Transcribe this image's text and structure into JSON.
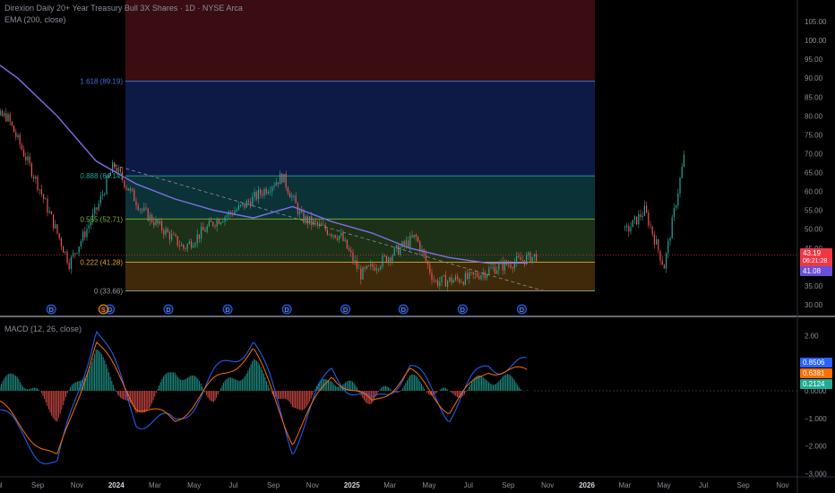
{
  "header": {
    "symbol_title": "Direxion Daily 20+ Year Treasury Bull 3X Shares · 1D · NYSE Arca",
    "indicator_title": "EMA (200, close)"
  },
  "macd_panel": {
    "title": "MACD (12, 26, close)"
  },
  "price_axis": {
    "ticks": [
      "105.00",
      "100.00",
      "95.00",
      "90.00",
      "85.00",
      "80.00",
      "75.00",
      "70.00",
      "65.00",
      "60.00",
      "55.00",
      "50.00",
      "45.00",
      "40.00",
      "35.00",
      "30.00"
    ]
  },
  "macd_axis": {
    "ticks": [
      "2.00",
      "1.00",
      "0.0000",
      "−1.000",
      "−2.000",
      "−3.000"
    ]
  },
  "time_axis": {
    "labels": [
      "Jul",
      "Sep",
      "Nov",
      "2024",
      "Mar",
      "May",
      "Jul",
      "Sep",
      "Nov",
      "2025",
      "Mar",
      "May",
      "Jul",
      "Sep",
      "Nov",
      "2026",
      "Mar",
      "May",
      "Jul",
      "Sep",
      "Nov"
    ]
  },
  "price_tags": {
    "last_price": "43.19",
    "countdown": "06:21:28",
    "ema_value": "41.08",
    "macd_value": "0.8506",
    "signal_value": "0.6381",
    "histogram_value": "0.2124"
  },
  "fib_levels": [
    {
      "label": "1.618 (89.19)",
      "price": 89.19,
      "color": "#3f6fd8",
      "fill": "#0d1a46"
    },
    {
      "label": "0.888 (64.14)",
      "price": 64.14,
      "color": "#26a69a",
      "fill": "#0b3236"
    },
    {
      "label": "0.555 (52.71)",
      "price": 52.71,
      "color": "#7fb83a",
      "fill": "#1c3117"
    },
    {
      "label": "0.222 (41.28)",
      "price": 41.28,
      "color": "#e6a52b",
      "fill": "#3e2a0a"
    },
    {
      "label": "0 (33.66)",
      "price": 33.66,
      "color": "#9e9e9e",
      "fill": ""
    }
  ],
  "dividend_marker": "D",
  "split_marker": "S",
  "colors": {
    "ema": "#7e6fe8",
    "macd_line": "#2962ff",
    "signal_line": "#ff6d00",
    "hist_up": "#26a69a",
    "hist_down": "#ef5350",
    "last_price": "#f23645"
  },
  "chart_data": [
    {
      "type": "candlestick",
      "title": "Direxion Daily 20+ Year Treasury Bull 3X Shares · 1D · NYSE Arca",
      "x_range": [
        "2023-06",
        "2026-12"
      ],
      "ylim": [
        30,
        107
      ],
      "series": [
        {
          "name": "EMA (200, close)",
          "x": [
            "2023-06-01",
            "2023-08-01",
            "2023-10-01",
            "2023-12-01",
            "2024-02-01",
            "2024-04-01",
            "2024-06-01",
            "2024-08-01",
            "2024-10-01",
            "2024-12-01",
            "2025-02-01",
            "2025-04-01",
            "2025-06-01",
            "2025-08-01",
            "2025-10-01"
          ],
          "values": [
            97.5,
            90,
            80,
            68,
            62,
            58,
            55,
            53,
            56,
            52,
            49,
            45,
            42.5,
            41,
            41.08
          ]
        },
        {
          "name": "price",
          "x": [
            "2023-06-01",
            "2023-07-15",
            "2023-09-01",
            "2023-10-20",
            "2023-12-01",
            "2023-12-28",
            "2024-02-10",
            "2024-04-15",
            "2024-06-01",
            "2024-07-15",
            "2024-09-15",
            "2024-10-15",
            "2024-12-15",
            "2025-01-15",
            "2025-03-01",
            "2025-04-10",
            "2025-05-10",
            "2025-07-01",
            "2025-08-15",
            "2025-10-15"
          ],
          "values": [
            79,
            80,
            62,
            41,
            55,
            67,
            55,
            45,
            52,
            56,
            64,
            53,
            48,
            38,
            43,
            48,
            36,
            37,
            40,
            43
          ]
        },
        {
          "name": "projection",
          "x": [
            "2026-03-01",
            "2026-04-01",
            "2026-05-01",
            "2026-06-01"
          ],
          "values": [
            49,
            55,
            40,
            69
          ]
        }
      ]
    },
    {
      "type": "bar",
      "title": "MACD (12, 26, close)",
      "ylim": [
        -3.1,
        2.6
      ],
      "series": [
        {
          "name": "histogram",
          "x": [
            "2023-06",
            "2023-08",
            "2023-10",
            "2023-12",
            "2024-02",
            "2024-04",
            "2024-06",
            "2024-08",
            "2024-10",
            "2024-12",
            "2025-02",
            "2025-04",
            "2025-06",
            "2025-08",
            "2025-10"
          ],
          "values": [
            -0.4,
            0.6,
            -0.9,
            1.4,
            -1.0,
            0.8,
            -0.2,
            1.0,
            -0.8,
            0.5,
            -0.3,
            0.4,
            -0.2,
            0.5,
            0.2124
          ]
        },
        {
          "name": "macd",
          "x": [
            "2023-06",
            "2023-08",
            "2023-10",
            "2023-12",
            "2024-02",
            "2024-04",
            "2024-06",
            "2024-08",
            "2024-10",
            "2024-12",
            "2025-02",
            "2025-04",
            "2025-06",
            "2025-08",
            "2025-10"
          ],
          "values": [
            0.3,
            -1.5,
            -2.8,
            2.4,
            -1.0,
            -1.2,
            0.5,
            1.9,
            -2.0,
            0.8,
            -0.6,
            0.9,
            -0.8,
            1.0,
            0.8506
          ]
        },
        {
          "name": "signal",
          "x": [
            "2023-06",
            "2023-08",
            "2023-10",
            "2023-12",
            "2024-02",
            "2024-04",
            "2024-06",
            "2024-08",
            "2024-10",
            "2024-12",
            "2025-02",
            "2025-04",
            "2025-06",
            "2025-08",
            "2025-10"
          ],
          "values": [
            0.4,
            -1.2,
            -2.5,
            1.8,
            -0.5,
            -1.1,
            0.3,
            1.5,
            -1.8,
            0.6,
            -0.5,
            0.7,
            -0.7,
            0.8,
            0.6381
          ]
        }
      ]
    }
  ]
}
